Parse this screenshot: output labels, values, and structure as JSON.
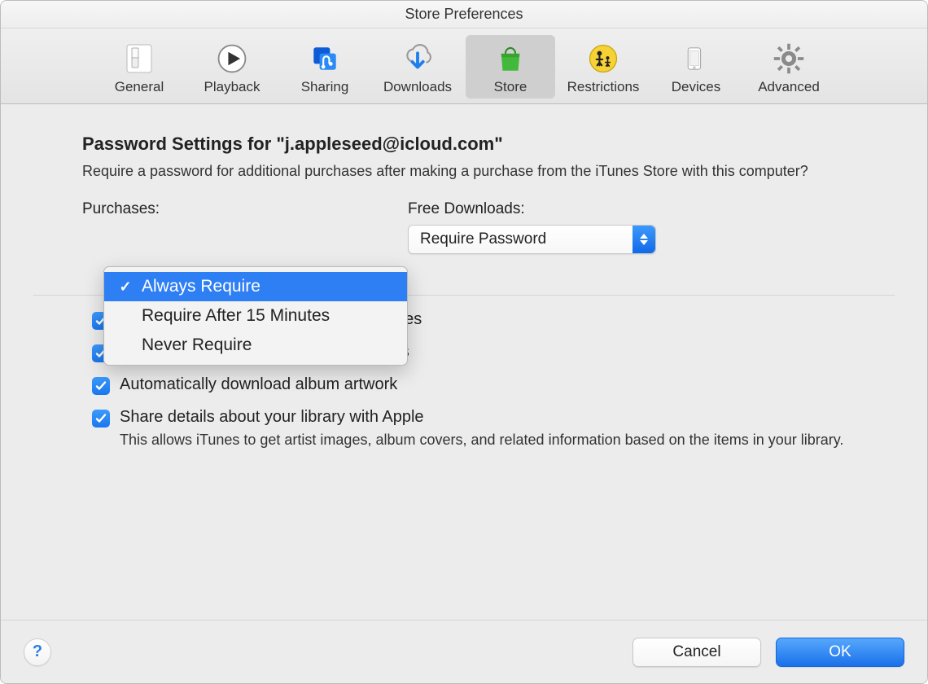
{
  "window": {
    "title": "Store Preferences"
  },
  "toolbar": {
    "items": [
      {
        "id": "general",
        "label": "General"
      },
      {
        "id": "playback",
        "label": "Playback"
      },
      {
        "id": "sharing",
        "label": "Sharing"
      },
      {
        "id": "downloads",
        "label": "Downloads"
      },
      {
        "id": "store",
        "label": "Store",
        "selected": true
      },
      {
        "id": "restrictions",
        "label": "Restrictions"
      },
      {
        "id": "devices",
        "label": "Devices"
      },
      {
        "id": "advanced",
        "label": "Advanced"
      }
    ]
  },
  "main": {
    "section_title": "Password Settings for \"j.appleseed@icloud.com\"",
    "section_desc": "Require a password for additional purchases after making a purchase from the iTunes Store with this computer?",
    "purchases": {
      "label": "Purchases:",
      "options": [
        "Always Require",
        "Require After 15 Minutes",
        "Never Require"
      ],
      "selected": "Always Require"
    },
    "free_downloads": {
      "label": "Free Downloads:",
      "selected": "Require Password"
    },
    "checkboxes": [
      {
        "label": "Sync playback information across devices",
        "checked": true
      },
      {
        "label": "Sync podcast subscriptions and settings",
        "checked": true
      },
      {
        "label": "Automatically download album artwork",
        "checked": true
      },
      {
        "label": "Share details about your library with Apple",
        "checked": true,
        "sub": "This allows iTunes to get artist images, album covers, and related information based on the items in your library."
      }
    ]
  },
  "footer": {
    "help": "?",
    "cancel": "Cancel",
    "ok": "OK"
  }
}
